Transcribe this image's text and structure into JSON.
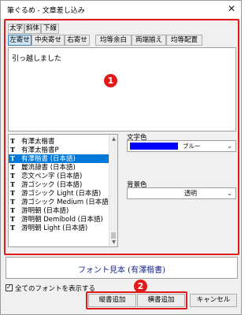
{
  "window": {
    "title": "筆ぐるめ - 文章差し込み",
    "close_label": "✕"
  },
  "style_buttons": {
    "bold": "太字",
    "italic": "斜体",
    "underline": "下線"
  },
  "align_buttons": {
    "left": "左寄せ",
    "center": "中央寄せ",
    "right": "右寄せ"
  },
  "spacing_buttons": {
    "even_margin": "均等余白",
    "justify": "両端揃え",
    "even_distribute": "均等配置"
  },
  "text_area": {
    "value": "引っ越しました"
  },
  "markers": {
    "one": "1",
    "two": "2"
  },
  "font_list": {
    "icon": "T",
    "items": [
      "有澤太楷書",
      "有澤太楷書P",
      "有澤楷書 (日本語)",
      "麗流隷書 (日本語)",
      "恋文ペン字 (日本語)",
      "游ゴシック (日本語)",
      "游ゴシック Light (日本語)",
      "游ゴシック Medium (日本語)",
      "游明朝 (日本語)",
      "游明朝 Demibold (日本語)",
      "游明朝 Light (日本語)"
    ],
    "selected_index": 2
  },
  "text_color": {
    "label": "文字色",
    "value": "ブルー",
    "swatch": "#0000ff"
  },
  "bg_color": {
    "label": "背景色",
    "value": "透明"
  },
  "preview": {
    "text": "フォント見本 (有澤楷書)"
  },
  "show_all_fonts": {
    "label": "全てのフォントを表示する",
    "checked": true,
    "mark": "✓"
  },
  "action_buttons": {
    "vertical": "縦書追加",
    "horizontal": "横書追加",
    "cancel": "キャンセル"
  }
}
